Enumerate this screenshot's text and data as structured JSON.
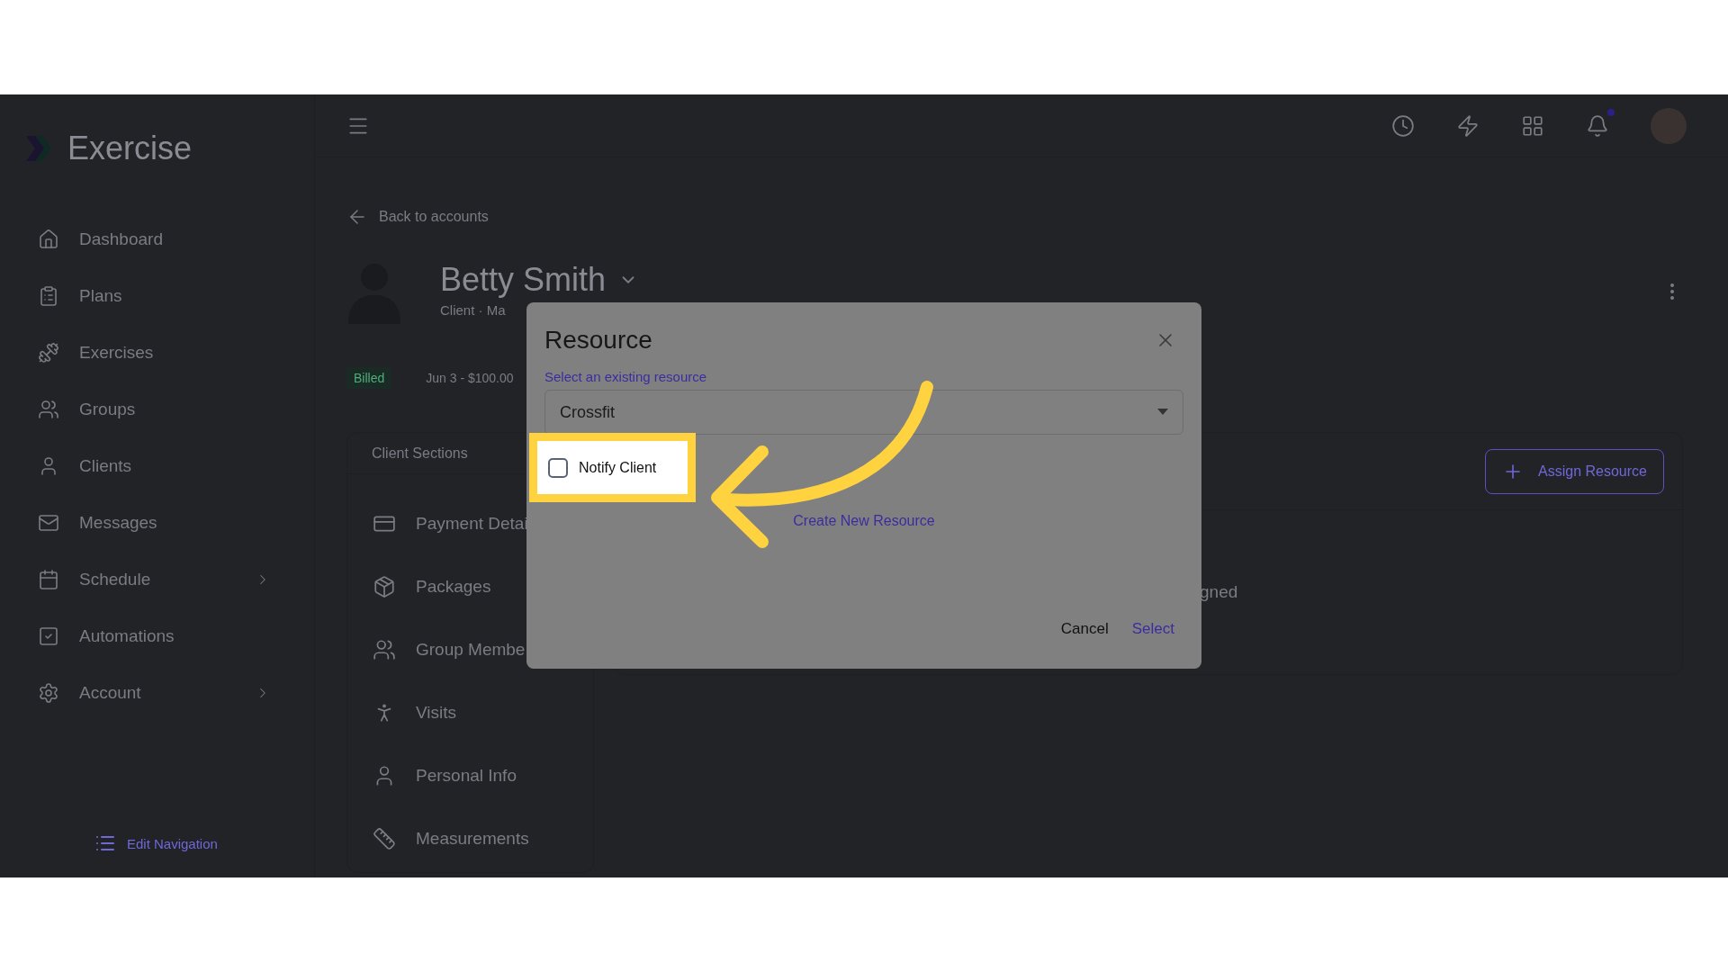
{
  "app": {
    "name": "Exercise"
  },
  "sidebar": {
    "items": [
      {
        "label": "Dashboard",
        "has_submenu": false
      },
      {
        "label": "Plans",
        "has_submenu": false
      },
      {
        "label": "Exercises",
        "has_submenu": false
      },
      {
        "label": "Groups",
        "has_submenu": false
      },
      {
        "label": "Clients",
        "has_submenu": false
      },
      {
        "label": "Messages",
        "has_submenu": false
      },
      {
        "label": "Schedule",
        "has_submenu": true
      },
      {
        "label": "Automations",
        "has_submenu": false
      },
      {
        "label": "Account",
        "has_submenu": true
      }
    ],
    "edit_navigation": "Edit Navigation"
  },
  "topbar": {
    "notification_dot": true
  },
  "client": {
    "back_link": "Back to accounts",
    "name": "Betty Smith",
    "subtitle": "Client · Ma",
    "badges": [
      {
        "label": "Billed",
        "kind": "status"
      },
      {
        "label": "Jun 3 - $100.00",
        "kind": "plain"
      }
    ]
  },
  "client_sections": {
    "title": "Client Sections",
    "items": [
      "Payment Detai",
      "Packages",
      "Group Membe",
      "Visits",
      "Personal Info",
      "Measurements"
    ]
  },
  "resources_panel": {
    "assign_button": "Assign Resource",
    "empty_text": "gned"
  },
  "dialog": {
    "title": "Resource",
    "field_label": "Select an existing resource",
    "select_value": "Crossfit",
    "notify": {
      "label": "Notify Client",
      "checked": false
    },
    "create_link": "Create New Resource",
    "buttons": [
      {
        "label": "Cancel",
        "kind": "secondary"
      },
      {
        "label": "Select",
        "kind": "primary"
      }
    ]
  }
}
